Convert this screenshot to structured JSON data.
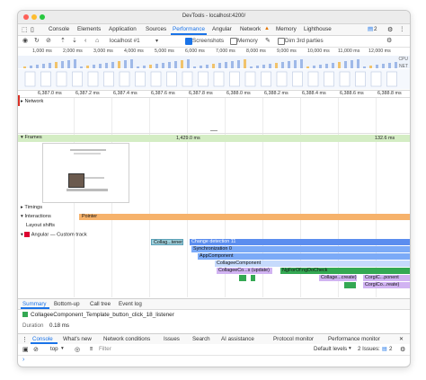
{
  "window": {
    "title": "DevTools - localhost:4200/"
  },
  "tabs": {
    "items": [
      "Console",
      "Elements",
      "Application",
      "Sources",
      "Performance",
      "Angular",
      "Network",
      "Memory",
      "Lighthouse"
    ],
    "active": "Performance",
    "issues_count": "2",
    "network_warning_icon": "warning-icon"
  },
  "toolbar": {
    "url": "localhost #1",
    "screenshots_label": "Screenshots",
    "memory_label": "Memory",
    "dim_label": "Dim 3rd parties"
  },
  "overview": {
    "ruler_labels": [
      "1,000 ms",
      "2,000 ms",
      "3,000 ms",
      "4,000 ms",
      "5,000 ms",
      "6,000 ms",
      "7,000 ms",
      "8,000 ms",
      "9,000 ms",
      "10,000 ms",
      "11,000 ms",
      "12,000 ms"
    ],
    "cpu_label": "CPU",
    "net_label": "NET"
  },
  "time_ruler": {
    "labels": [
      "6,387.0 ms",
      "6,387.2 ms",
      "6,387.4 ms",
      "6,387.6 ms",
      "6,387.8 ms",
      "6,388.0 ms",
      "6,388.2 ms",
      "6,388.4 ms",
      "6,388.6 ms",
      "6,388.8 ms"
    ]
  },
  "tracks": {
    "network": "Network",
    "frames": "Frames",
    "frame_duration_1": "1,429.0 ms",
    "frame_duration_2": "132.6 ms",
    "timings": "Timings",
    "interactions": "Interactions",
    "pointer": "Pointer",
    "layout_shifts": "Layout shifts",
    "angular": "Angular — Custom track"
  },
  "flame": {
    "collage_tener": "Collag...tener",
    "change_detection": "Change detection 11",
    "synchronization": "Synchronization 0",
    "app_component": "AppComponent",
    "collagee_component": "CollageeComponent",
    "collagee_update": "CollageeCo...s (update)",
    "ng_docheck": "NgForOf:ngDoCheck",
    "collage_create": "Collage...create)",
    "corgi_component": "CorgiC...ponent",
    "corgi_create": "CorgiCo...reate)"
  },
  "bottom_tabs": {
    "items": [
      "Summary",
      "Bottom-up",
      "Call tree",
      "Event log"
    ],
    "active": "Summary"
  },
  "summary": {
    "event_name": "CollageeComponent_Template_button_click_18_listener",
    "duration_label": "Duration",
    "duration_value": "0.18 ms"
  },
  "drawer_tabs": {
    "items": [
      "Console",
      "What's new",
      "Network conditions",
      "Issues",
      "Search",
      "AI assistance",
      "Protocol monitor",
      "Performance monitor"
    ],
    "active": "Console"
  },
  "console_bar": {
    "context": "top",
    "filter_placeholder": "Filter",
    "levels": "Default levels",
    "issues": "2 Issues:",
    "issues_count": "2"
  },
  "colors": {
    "accent": "#1a73e8",
    "pointer": "#f6b26b",
    "frames": "#d4edc4",
    "change_detection": "#5b8def",
    "app_component": "#7baaf7",
    "collagee": "#c6dafc",
    "purple": "#d1b3f2",
    "green": "#34a853"
  }
}
